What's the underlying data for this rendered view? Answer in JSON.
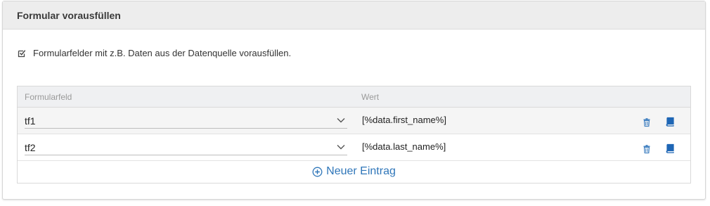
{
  "panel": {
    "title": "Formular vorausfüllen"
  },
  "prefill_option": {
    "label": "Formularfelder mit z.B. Daten aus der Datenquelle vorausfüllen.",
    "checked": true
  },
  "table": {
    "columns": [
      "Formularfeld",
      "Wert"
    ],
    "rows": [
      {
        "field": "tf1",
        "value": "[%data.first_name%]"
      },
      {
        "field": "tf2",
        "value": "[%data.last_name%]"
      }
    ],
    "add_label": "Neuer Eintrag"
  },
  "icons": {
    "checkbox": "checkbox-checked-icon",
    "dropdown": "chevron-down-icon",
    "delete": "trash-icon",
    "edit": "book-icon",
    "add": "plus-circle-icon"
  },
  "colors": {
    "accent": "#2f76b9",
    "header_bg": "#ededed"
  }
}
